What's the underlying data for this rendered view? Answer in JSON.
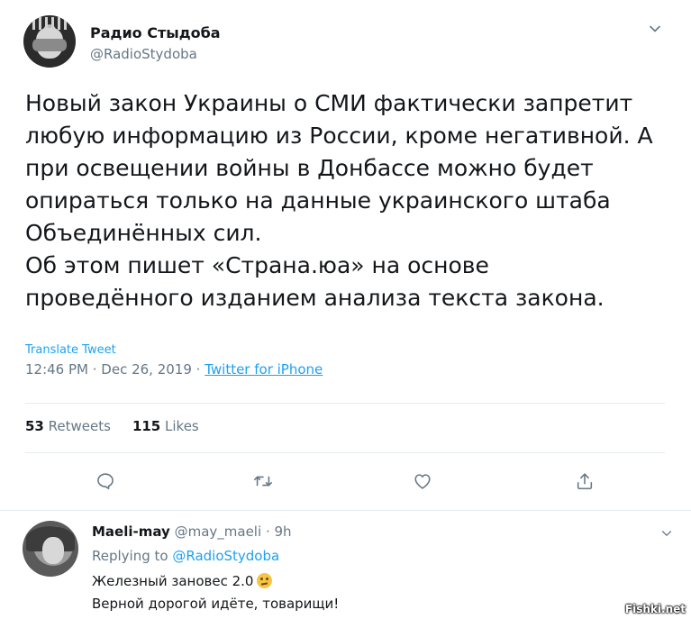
{
  "tweet": {
    "display_name": "Радио Стыдоба",
    "handle": "@RadioStydoba",
    "text": "Новый закон Украины о СМИ фактически запретит\nлюбую информацию из России, кроме негативной. А\nпри освещении войны в Донбассе можно будет\nопираться только на данные украинского штаба\nОбъединённых сил.\nОб этом пишет «Страна.юа» на основе\nпроведённого изданием анализа текста закона.",
    "translate_label": "Translate Tweet",
    "time": "12:46 PM",
    "date": "Dec 26, 2019",
    "separator": " · ",
    "source": "Twitter for iPhone",
    "retweets_count": "53",
    "retweets_label": "Retweets",
    "likes_count": "115",
    "likes_label": "Likes"
  },
  "reply": {
    "name": "Maeli-may",
    "handle": "@may_maeli",
    "age": "· 9h",
    "replying_prefix": "Replying to",
    "replying_to": "@RadioStydoba",
    "text_line1": "Железный зановес 2.0",
    "text_line2": "Верной дорогой идёте, товарищи!",
    "emoji": "thinking-face-emoji"
  },
  "watermark": "Fishki.net",
  "colors": {
    "accent": "#1da1f2",
    "secondary_text": "#657786",
    "primary_text": "#14171a",
    "divider": "#e6ecf0"
  },
  "icons": {
    "menu": "chevron-down-icon",
    "reply": "comment-icon",
    "retweet": "retweet-icon",
    "like": "heart-icon",
    "share": "share-icon"
  }
}
